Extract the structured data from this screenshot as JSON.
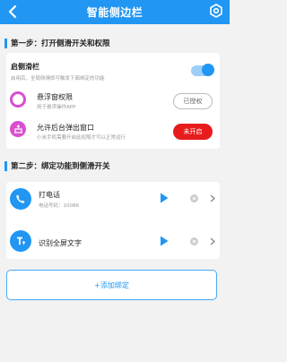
{
  "header": {
    "title": "智能侧边栏"
  },
  "step1": {
    "label": "第一步：打开侧滑开关和权限",
    "enable": {
      "title": "启侧滑栏",
      "subtitle": "启用后，全局侧滑即可触发下面绑定的功能",
      "on": true
    },
    "overlay": {
      "title": "悬浮窗权限",
      "subtitle": "用于悬浮操作APP",
      "button": "已授权"
    },
    "background": {
      "title": "允许后台弹出窗口",
      "subtitle": "小米手机需要开启此权限才可以正常运行",
      "button": "未开启"
    }
  },
  "step2": {
    "label": "第二步：绑定功能到侧滑开关",
    "items": [
      {
        "title": "打电话",
        "subtitle": "电话号码：10086"
      },
      {
        "title": "识别全屏文字",
        "subtitle": ""
      }
    ]
  },
  "add_button": {
    "label": "+添加绑定"
  },
  "colors": {
    "accent": "#2196f3",
    "danger": "#e81c1c",
    "background": "#f2f2f2"
  }
}
